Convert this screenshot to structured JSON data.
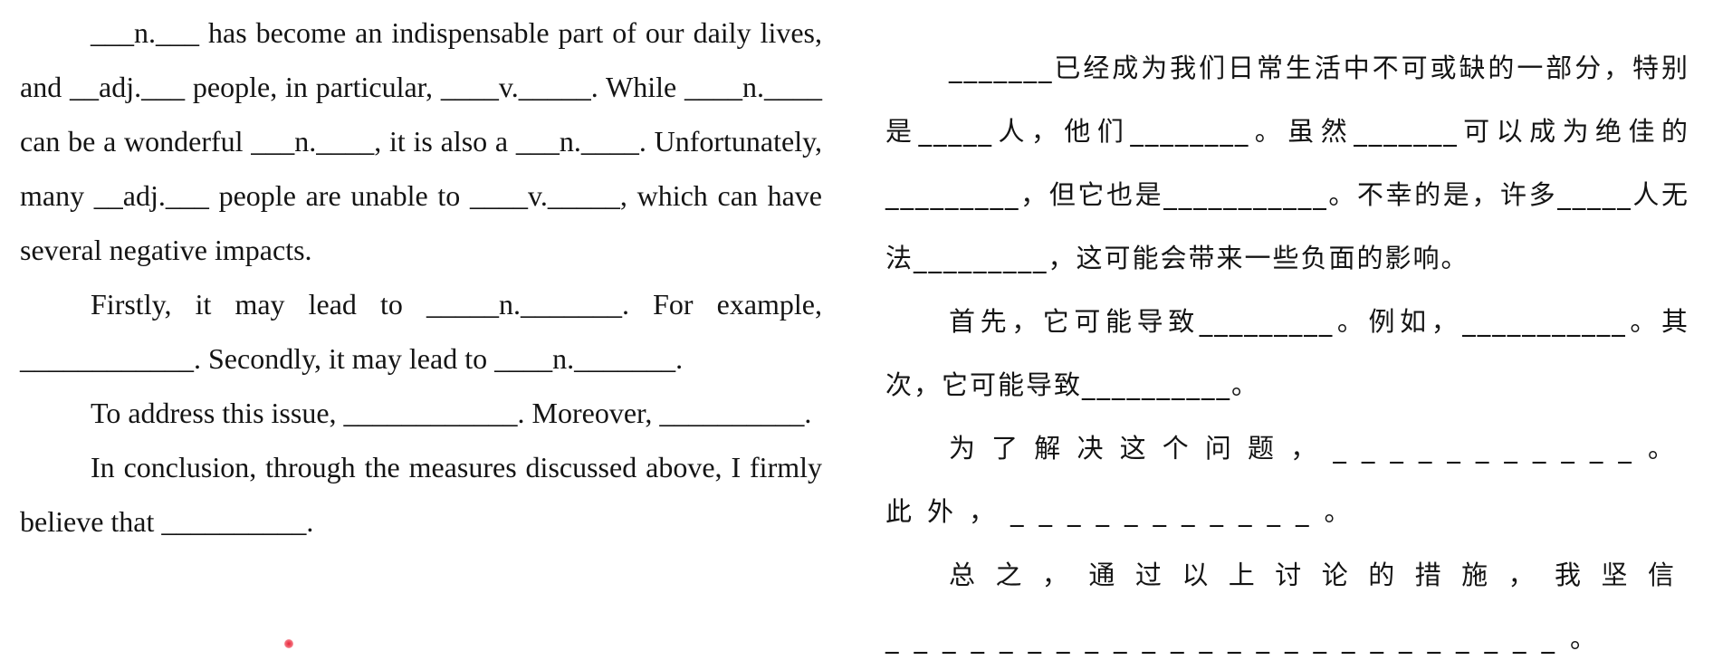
{
  "english": {
    "paragraphs": [
      "___n.___ has become an indispensable part of our daily lives, and __adj.___ people, in particular, ____v._____. While ____n.____ can be a wonderful ___n.____, it is also a ___n.____. Unfortunately, many __adj.___ people are unable to ____v._____, which can have several negative impacts.",
      "Firstly, it may lead to _____n._______. For example, ____________. Secondly, it may lead to ____n._______.",
      "To address this issue, ____________. Moreover, __________.",
      "In conclusion, through the measures discussed above, I firmly believe that __________."
    ]
  },
  "chinese": {
    "paragraphs": [
      "_______已经成为我们日常生活中不可或缺的一部分，特别是_____人，他们________。虽然_______可以成为绝佳的_________，但它也是___________。不幸的是，许多_____人无法_________，这可能会带来一些负面的影响。",
      "首先，它可能导致_________。例如，___________。其次，它可能导致__________。",
      "为了解决这个问题，___________。此外，___________。",
      "总之，通过以上讨论的措施，我坚信________________________。"
    ]
  },
  "colors": {
    "text": "#141414",
    "background": "#ffffff",
    "marker": "#e8263a"
  }
}
